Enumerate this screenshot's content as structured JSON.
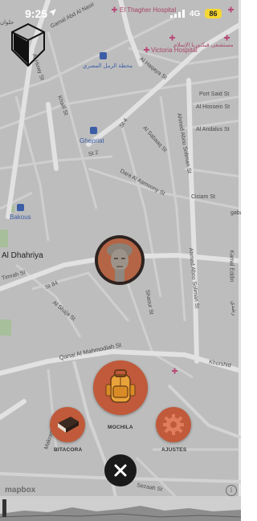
{
  "status": {
    "time": "9:25",
    "network": "4G",
    "battery": "86"
  },
  "map": {
    "labels": {
      "gamal": "Gamal Abd Al Nasir",
      "el_thagher": "El Thagher Hospital",
      "victoria_en": "Victoria Hospital",
      "victoria_ar": "مستشفى فيكتوريا الإسلام",
      "al_huwy": "Al Huwy St",
      "raml_station": "محطة الرمل المصري",
      "al_haqaya": "Al Haqaya St",
      "port_said": "Port Said St",
      "al_hossein": "Al Hossein St",
      "al_andalus": "Al Andalus St",
      "ghepriat": "Ghepriat",
      "al_sabaaq": "Al Sabaaq St",
      "ahmed_soliman_1": "Ahmed Abou Soliman St",
      "khalil": "Khalil St",
      "st4": "St 4",
      "st2": "St 2",
      "bakous": "Bakous",
      "dara": "Dara Al Asmoony St",
      "ciciam": "Ciciam St",
      "al_dhahriya": "Al Dhahriya",
      "gaba": "gaba",
      "kamal": "Kamal Eddin",
      "timrah": "Timrah St",
      "st84": "St 84",
      "al_shaja": "Al Shaja St",
      "shaour": "Shaour St",
      "ahmed_soliman_2": "Ahmed Abou Soliman St",
      "qanai": "Qanai Al Mahmodiah St",
      "khorshid": "Khorshid",
      "makram": "Makram St",
      "sezaah": "Sezaah St",
      "top_ar": "حلوان",
      "right_ar": "الإسلام",
      "right_ar2": "رشدي"
    }
  },
  "menu": {
    "mochila_label": "MOCHILA",
    "bitacora_label": "BITACORA",
    "ajustes_label": "AJUSTES"
  },
  "attribution": {
    "logo_text": "mapbox",
    "info_symbol": "i"
  },
  "colors": {
    "accent": "#c05a3a",
    "map_bg": "#bfbfbf",
    "road": "#d7d7d7",
    "dark": "#1a1a1a"
  }
}
